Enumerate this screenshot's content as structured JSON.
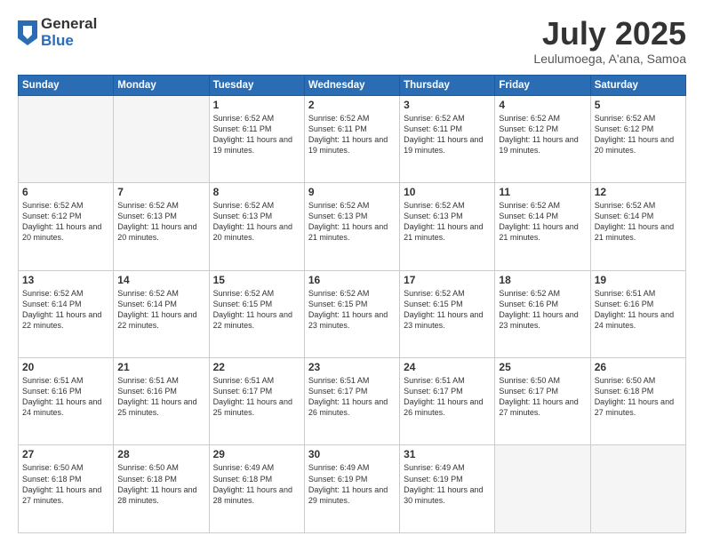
{
  "logo": {
    "general": "General",
    "blue": "Blue"
  },
  "title": "July 2025",
  "location": "Leulumoega, A'ana, Samoa",
  "days_header": [
    "Sunday",
    "Monday",
    "Tuesday",
    "Wednesday",
    "Thursday",
    "Friday",
    "Saturday"
  ],
  "weeks": [
    [
      {
        "day": "",
        "info": ""
      },
      {
        "day": "",
        "info": ""
      },
      {
        "day": "1",
        "info": "Sunrise: 6:52 AM\nSunset: 6:11 PM\nDaylight: 11 hours and 19 minutes."
      },
      {
        "day": "2",
        "info": "Sunrise: 6:52 AM\nSunset: 6:11 PM\nDaylight: 11 hours and 19 minutes."
      },
      {
        "day": "3",
        "info": "Sunrise: 6:52 AM\nSunset: 6:11 PM\nDaylight: 11 hours and 19 minutes."
      },
      {
        "day": "4",
        "info": "Sunrise: 6:52 AM\nSunset: 6:12 PM\nDaylight: 11 hours and 19 minutes."
      },
      {
        "day": "5",
        "info": "Sunrise: 6:52 AM\nSunset: 6:12 PM\nDaylight: 11 hours and 20 minutes."
      }
    ],
    [
      {
        "day": "6",
        "info": "Sunrise: 6:52 AM\nSunset: 6:12 PM\nDaylight: 11 hours and 20 minutes."
      },
      {
        "day": "7",
        "info": "Sunrise: 6:52 AM\nSunset: 6:13 PM\nDaylight: 11 hours and 20 minutes."
      },
      {
        "day": "8",
        "info": "Sunrise: 6:52 AM\nSunset: 6:13 PM\nDaylight: 11 hours and 20 minutes."
      },
      {
        "day": "9",
        "info": "Sunrise: 6:52 AM\nSunset: 6:13 PM\nDaylight: 11 hours and 21 minutes."
      },
      {
        "day": "10",
        "info": "Sunrise: 6:52 AM\nSunset: 6:13 PM\nDaylight: 11 hours and 21 minutes."
      },
      {
        "day": "11",
        "info": "Sunrise: 6:52 AM\nSunset: 6:14 PM\nDaylight: 11 hours and 21 minutes."
      },
      {
        "day": "12",
        "info": "Sunrise: 6:52 AM\nSunset: 6:14 PM\nDaylight: 11 hours and 21 minutes."
      }
    ],
    [
      {
        "day": "13",
        "info": "Sunrise: 6:52 AM\nSunset: 6:14 PM\nDaylight: 11 hours and 22 minutes."
      },
      {
        "day": "14",
        "info": "Sunrise: 6:52 AM\nSunset: 6:14 PM\nDaylight: 11 hours and 22 minutes."
      },
      {
        "day": "15",
        "info": "Sunrise: 6:52 AM\nSunset: 6:15 PM\nDaylight: 11 hours and 22 minutes."
      },
      {
        "day": "16",
        "info": "Sunrise: 6:52 AM\nSunset: 6:15 PM\nDaylight: 11 hours and 23 minutes."
      },
      {
        "day": "17",
        "info": "Sunrise: 6:52 AM\nSunset: 6:15 PM\nDaylight: 11 hours and 23 minutes."
      },
      {
        "day": "18",
        "info": "Sunrise: 6:52 AM\nSunset: 6:16 PM\nDaylight: 11 hours and 23 minutes."
      },
      {
        "day": "19",
        "info": "Sunrise: 6:51 AM\nSunset: 6:16 PM\nDaylight: 11 hours and 24 minutes."
      }
    ],
    [
      {
        "day": "20",
        "info": "Sunrise: 6:51 AM\nSunset: 6:16 PM\nDaylight: 11 hours and 24 minutes."
      },
      {
        "day": "21",
        "info": "Sunrise: 6:51 AM\nSunset: 6:16 PM\nDaylight: 11 hours and 25 minutes."
      },
      {
        "day": "22",
        "info": "Sunrise: 6:51 AM\nSunset: 6:17 PM\nDaylight: 11 hours and 25 minutes."
      },
      {
        "day": "23",
        "info": "Sunrise: 6:51 AM\nSunset: 6:17 PM\nDaylight: 11 hours and 26 minutes."
      },
      {
        "day": "24",
        "info": "Sunrise: 6:51 AM\nSunset: 6:17 PM\nDaylight: 11 hours and 26 minutes."
      },
      {
        "day": "25",
        "info": "Sunrise: 6:50 AM\nSunset: 6:17 PM\nDaylight: 11 hours and 27 minutes."
      },
      {
        "day": "26",
        "info": "Sunrise: 6:50 AM\nSunset: 6:18 PM\nDaylight: 11 hours and 27 minutes."
      }
    ],
    [
      {
        "day": "27",
        "info": "Sunrise: 6:50 AM\nSunset: 6:18 PM\nDaylight: 11 hours and 27 minutes."
      },
      {
        "day": "28",
        "info": "Sunrise: 6:50 AM\nSunset: 6:18 PM\nDaylight: 11 hours and 28 minutes."
      },
      {
        "day": "29",
        "info": "Sunrise: 6:49 AM\nSunset: 6:18 PM\nDaylight: 11 hours and 28 minutes."
      },
      {
        "day": "30",
        "info": "Sunrise: 6:49 AM\nSunset: 6:19 PM\nDaylight: 11 hours and 29 minutes."
      },
      {
        "day": "31",
        "info": "Sunrise: 6:49 AM\nSunset: 6:19 PM\nDaylight: 11 hours and 30 minutes."
      },
      {
        "day": "",
        "info": ""
      },
      {
        "day": "",
        "info": ""
      }
    ]
  ]
}
